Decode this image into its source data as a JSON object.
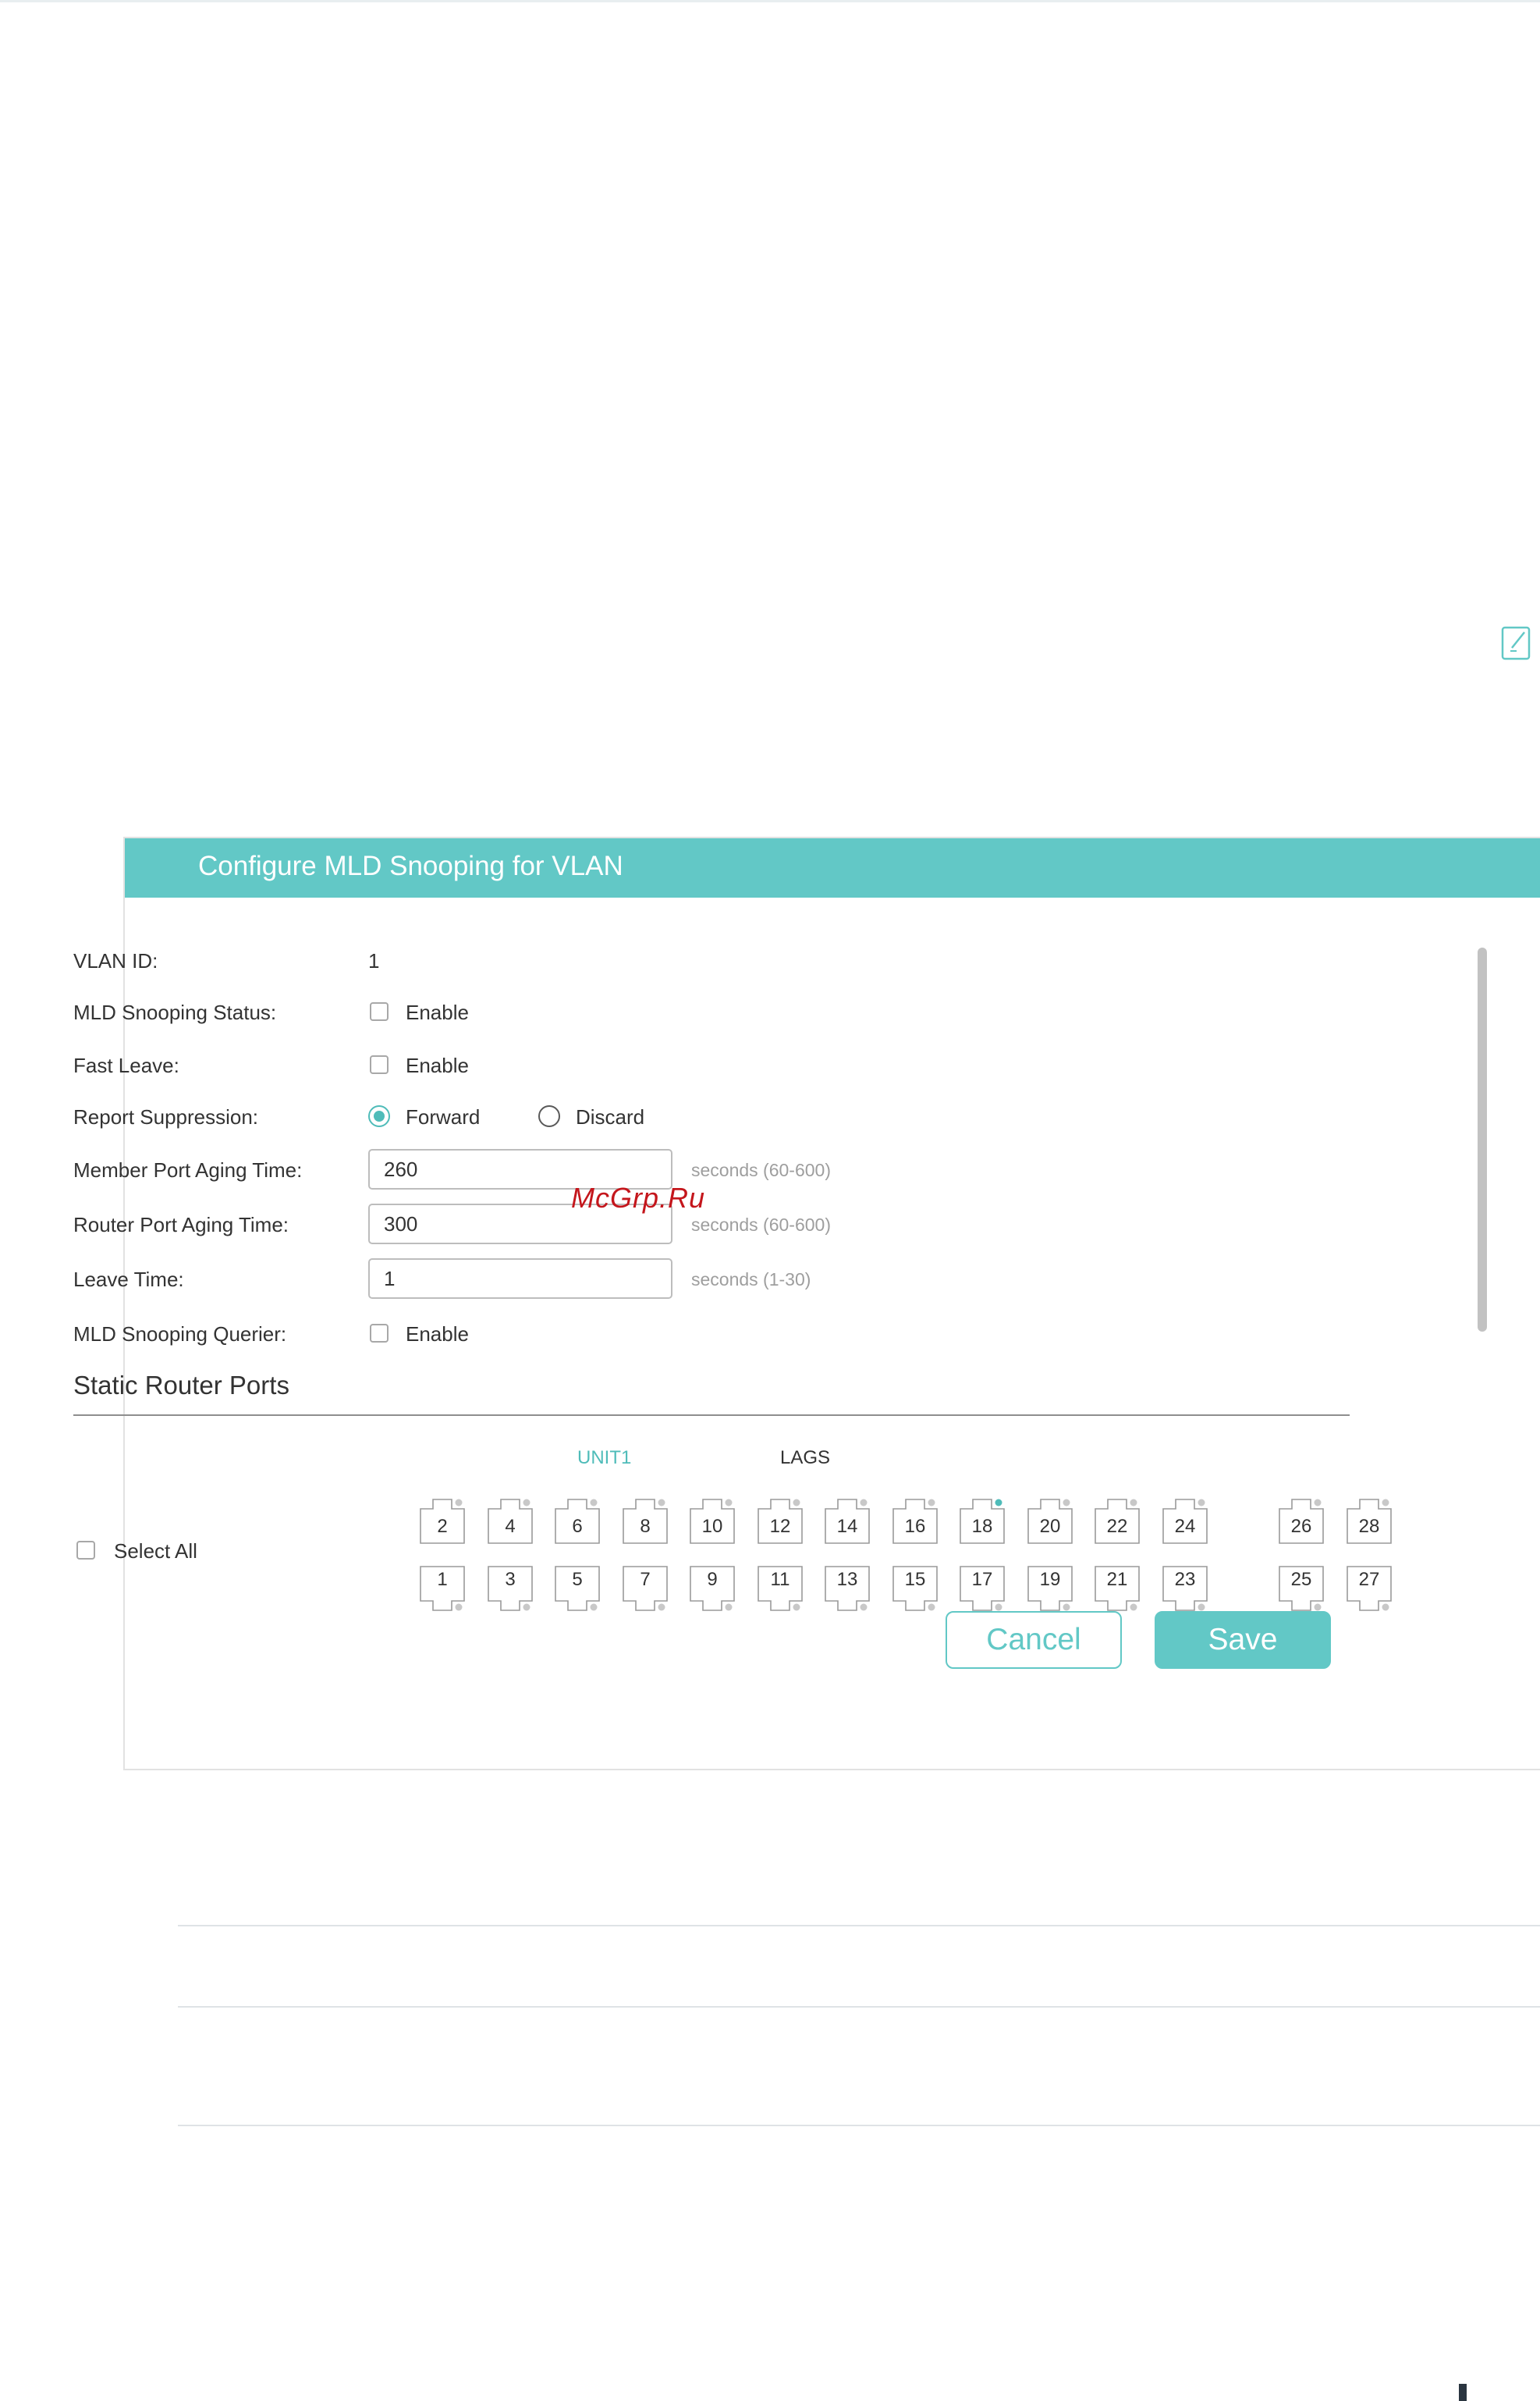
{
  "dialog": {
    "title": "Configure MLD Snooping for VLAN"
  },
  "form": {
    "vlan_id_label": "VLAN ID:",
    "vlan_id_value": "1",
    "snooping_status_label": "MLD Snooping Status:",
    "snooping_status_option": "Enable",
    "snooping_status_checked": false,
    "fast_leave_label": "Fast Leave:",
    "fast_leave_option": "Enable",
    "fast_leave_checked": false,
    "report_suppression_label": "Report Suppression:",
    "report_forward_label": "Forward",
    "report_discard_label": "Discard",
    "report_selected": "Forward",
    "member_port_aging_label": "Member Port Aging Time:",
    "member_port_aging_value": "260",
    "member_port_aging_hint": "seconds (60-600)",
    "router_port_aging_label": "Router Port Aging Time:",
    "router_port_aging_value": "300",
    "router_port_aging_hint": "seconds (60-600)",
    "leave_time_label": "Leave Time:",
    "leave_time_value": "1",
    "leave_time_hint": "seconds (1-30)",
    "querier_label": "MLD Snooping Querier:",
    "querier_option": "Enable",
    "querier_checked": false
  },
  "watermark": "McGrp.Ru",
  "static_router_ports": {
    "title": "Static Router Ports",
    "unit_label": "UNIT1",
    "lags_label": "LAGS",
    "select_all_label": "Select All",
    "top_row": [
      "2",
      "4",
      "6",
      "8",
      "10",
      "12",
      "14",
      "16",
      "18",
      "20",
      "22",
      "24",
      "26",
      "28"
    ],
    "bottom_row": [
      "1",
      "3",
      "5",
      "7",
      "9",
      "11",
      "13",
      "15",
      "17",
      "19",
      "21",
      "23",
      "25",
      "27"
    ],
    "active_ports": [
      "18"
    ]
  },
  "buttons": {
    "cancel_label": "Cancel",
    "save_label": "Save"
  },
  "icons": {
    "edit": "edit-icon"
  },
  "colors": {
    "accent": "#62c8c6",
    "port_active_dot": "#4fbcb9",
    "port_idle_dot": "#c8c8c8",
    "watermark": "#c4161c"
  }
}
